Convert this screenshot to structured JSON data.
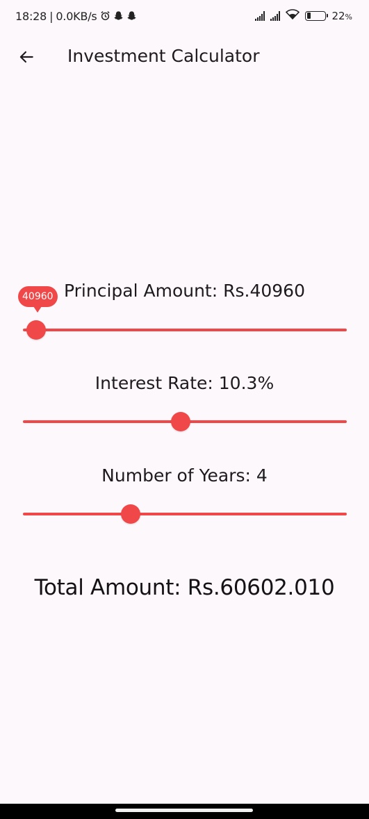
{
  "status_bar": {
    "time": "18:28",
    "separator": "|",
    "speed": "0.0KB/s",
    "battery": "22",
    "battery_unit": "%",
    "battery_level": 0.22,
    "icons": [
      "alarm-icon",
      "snapchat-icon",
      "snapchat-icon",
      "signal-icon",
      "signal-icon",
      "wifi-icon",
      "battery-icon"
    ]
  },
  "app_bar": {
    "title": "Investment Calculator",
    "back_icon": "arrow-left-icon"
  },
  "principal": {
    "label": "Principal Amount: Rs.40960",
    "value": 40960,
    "value_label": "40960",
    "fraction": 0.04
  },
  "interest": {
    "label": "Interest Rate: 10.3%",
    "value": 10.3,
    "fraction": 0.487
  },
  "years": {
    "label": "Number of Years: 4",
    "value": 4,
    "fraction": 0.333
  },
  "total": {
    "label": "Total Amount: Rs.60602.010"
  },
  "colors": {
    "accent": "#f04848",
    "background": "#fdf8fb",
    "text": "#1d1b1e"
  }
}
